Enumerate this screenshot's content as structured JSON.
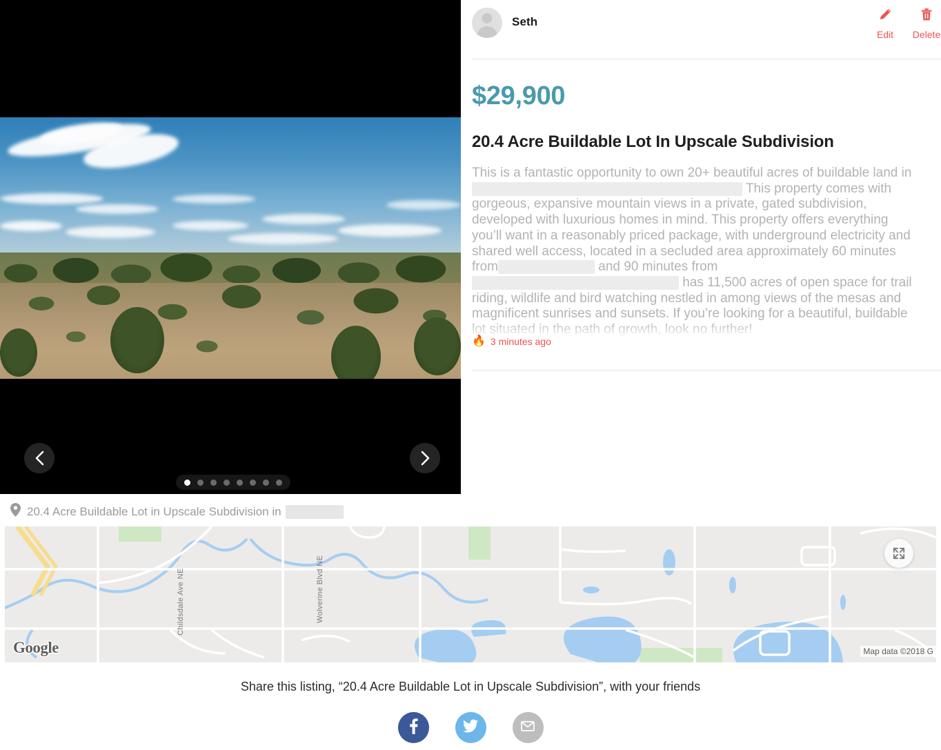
{
  "seller": {
    "name": "Seth",
    "avatar_icon": "user-avatar-icon"
  },
  "actions": {
    "edit_label": "Edit",
    "edit_icon": "pencil-icon",
    "delete_label": "Delete",
    "delete_icon": "trash-icon",
    "accent_color": "#ef5350"
  },
  "listing": {
    "price": "$29,900",
    "price_color": "#4a9aad",
    "title": "20.4 Acre Buildable Lot In Upscale Subdivision",
    "description_part_1": "This is a fantastic opportunity to own 20+ beautiful acres of buildable land in",
    "description_part_2": "This property comes with gorgeous, expansive mountain views in a private, gated subdivision, developed with luxurious homes in mind. This property offers everything you’ll want in a reasonably priced package, with underground electricity and shared well access, located in a secluded area approximately 60 minutes from",
    "description_part_3": "and 90 minutes from",
    "description_part_4": "has 11,500 acres of open space for trail riding, wildlife and bird watching nestled in among views of the mesas and magnificent sunrises and sunsets. If you’re looking for a beautiful, buildable lot situated in the path of growth, look no further!",
    "posted_time": "3 minutes ago",
    "posted_icon": "flame-icon"
  },
  "carousel": {
    "prev_icon": "chevron-left-icon",
    "next_icon": "chevron-right-icon",
    "total_slides": 8,
    "active_slide": 1
  },
  "location": {
    "pin_icon": "map-pin-icon",
    "label": "20.4 Acre Buildable Lot in Upscale Subdivision in"
  },
  "map": {
    "provider_logo": "Google",
    "attribution": "Map data ©2018 G",
    "fullscreen_icon": "fullscreen-expand-icon",
    "road_labels": [
      "Childsdale Ave NE",
      "Wolverine Blvd NE"
    ]
  },
  "share": {
    "prompt": "Share this listing, “20.4 Acre Buildable Lot in Upscale Subdivision”, with your friends",
    "buttons": [
      {
        "name": "facebook",
        "icon": "facebook-icon",
        "color": "#3b5998"
      },
      {
        "name": "twitter",
        "icon": "twitter-icon",
        "color": "#6cb6ea"
      },
      {
        "name": "email",
        "icon": "envelope-icon",
        "color": "#bdbdbd"
      }
    ]
  }
}
